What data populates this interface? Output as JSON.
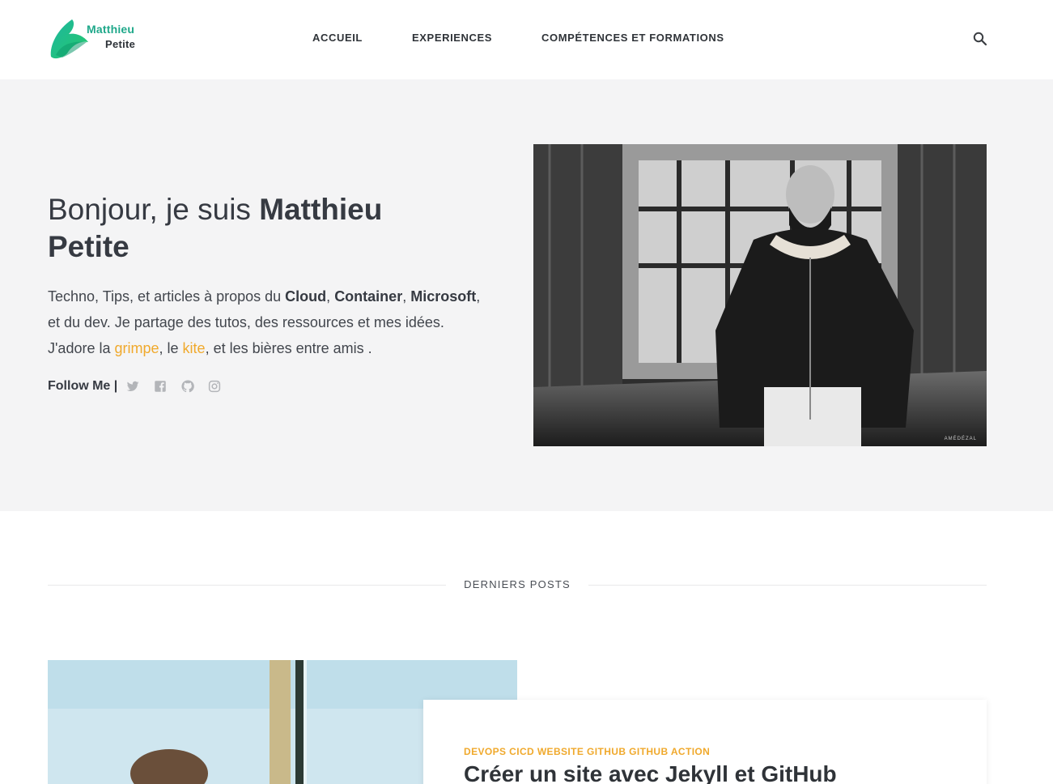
{
  "header": {
    "logo": {
      "line1": "Matthieu",
      "line2": "Petite"
    },
    "nav": [
      {
        "label": "ACCUEIL"
      },
      {
        "label": "EXPERIENCES"
      },
      {
        "label": "COMPÉTENCES ET FORMATIONS"
      }
    ],
    "search_icon": "search-icon"
  },
  "hero": {
    "greeting": "Bonjour, je suis ",
    "name": "Matthieu Petite",
    "intro": {
      "t1": "Techno, Tips, et articles à propos du ",
      "cloud": "Cloud",
      "t2": ", ",
      "container": "Container",
      "t3": ", ",
      "microsoft": "Microsoft",
      "t4": ", et du dev. Je partage des tutos, des ressources et mes idées. J'adore la ",
      "grimpe": "grimpe",
      "t5": ", le ",
      "kite": "kite",
      "t6": ", et les bières entre amis ."
    },
    "follow_label": "Follow Me |",
    "social_icons": [
      "twitter-icon",
      "facebook-icon",
      "github-icon",
      "instagram-icon"
    ],
    "photo_watermark": "AMÉDÉZAL"
  },
  "latest": {
    "section_label": "DERNIERS POSTS",
    "post": {
      "tags": "DEVOPS CICD WEBSITE GITHUB GITHUB ACTION",
      "title": "Créer un site avec Jekyll et GitHub"
    }
  },
  "colors": {
    "accent": "#f0a92c",
    "brand_green": "#1fa88a",
    "hero_bg": "#f4f4f5",
    "text_dark": "#363a42"
  }
}
